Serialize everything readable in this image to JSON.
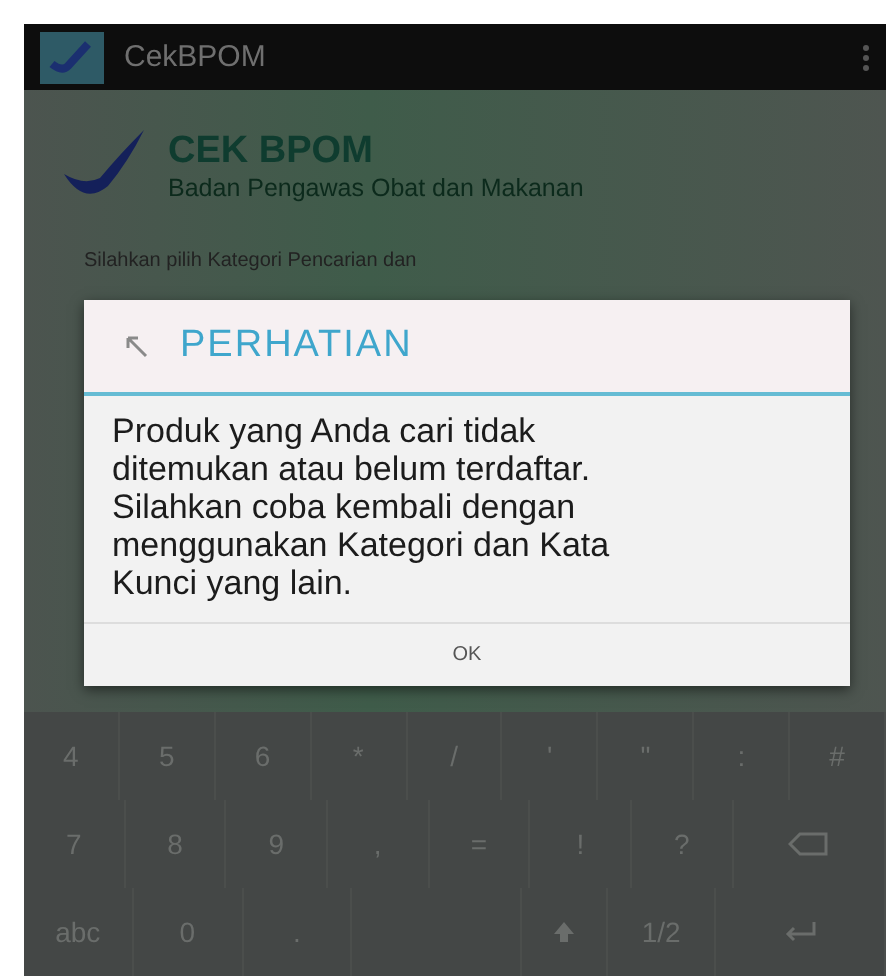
{
  "action_bar": {
    "title": "CekBPOM"
  },
  "header": {
    "title": "CEK BPOM",
    "subtitle": "Badan Pengawas Obat dan Makanan"
  },
  "instruction": "Silahkan pilih Kategori Pencarian dan",
  "dialog": {
    "title": "PERHATIAN",
    "message": "Produk yang Anda cari tidak ditemukan atau belum terdaftar. Silahkan coba kembali dengan menggunakan Kategori dan Kata Kunci yang lain.",
    "buttons": [
      "OK"
    ]
  },
  "keyboard": {
    "rows": [
      {
        "keys": [
          {
            "label": "4"
          },
          {
            "label": "5"
          },
          {
            "label": "6"
          },
          {
            "label": "*"
          },
          {
            "label": "/"
          },
          {
            "label": "'"
          },
          {
            "label": "\""
          },
          {
            "label": ":"
          },
          {
            "label": "#"
          }
        ]
      },
      {
        "keys": [
          {
            "label": "7"
          },
          {
            "label": "8"
          },
          {
            "label": "9"
          },
          {
            "label": ","
          },
          {
            "label": "="
          },
          {
            "label": "!"
          },
          {
            "label": "?"
          },
          {
            "kind": "backspace"
          }
        ]
      },
      {
        "keys": [
          {
            "label": "abc"
          },
          {
            "label": "0"
          },
          {
            "label": "."
          },
          {
            "kind": "space"
          },
          {
            "kind": "shift"
          },
          {
            "label": "1/2"
          },
          {
            "kind": "enter"
          }
        ]
      }
    ]
  }
}
